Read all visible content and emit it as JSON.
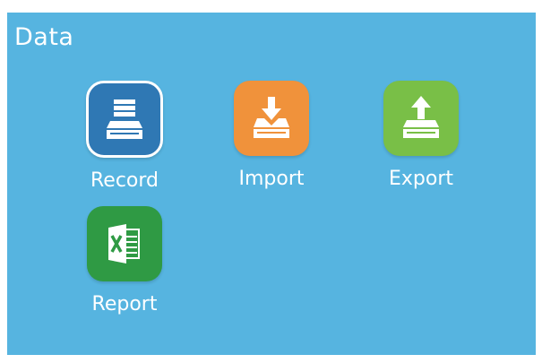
{
  "header": {
    "title": "Data"
  },
  "tiles": [
    {
      "label": "Record",
      "icon": "record-drawer-icon",
      "color": "#2f78b4"
    },
    {
      "label": "Import",
      "icon": "import-download-icon",
      "color": "#f0923b"
    },
    {
      "label": "Export",
      "icon": "export-upload-icon",
      "color": "#79bf47"
    },
    {
      "label": "Report",
      "icon": "excel-report-icon",
      "color": "#2f9a44"
    }
  ],
  "colors": {
    "background": "#56b4e0",
    "text": "#ffffff"
  }
}
